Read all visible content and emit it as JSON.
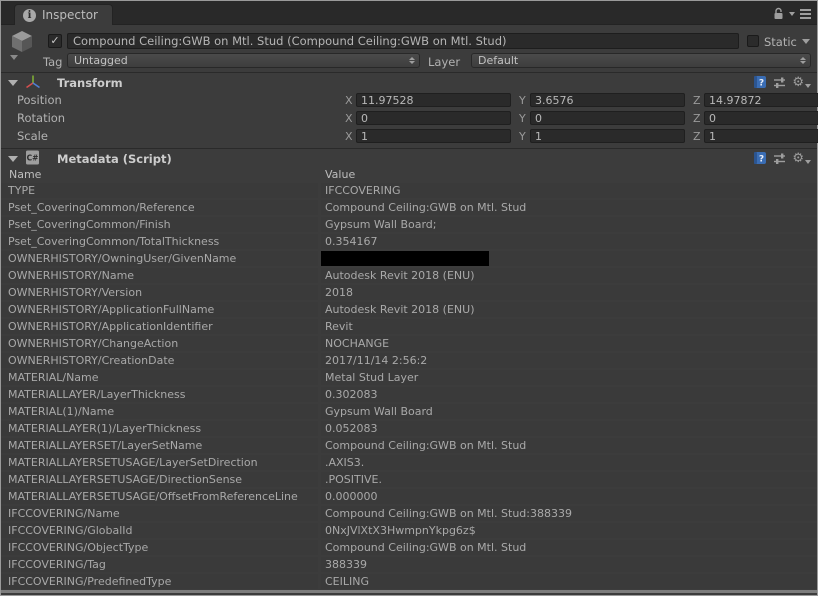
{
  "window": {
    "tab": "Inspector"
  },
  "game_object": {
    "name": "Compound Ceiling:GWB on Mtl. Stud (Compound Ceiling:GWB on Mtl. Stud)",
    "active": true,
    "static_label": "Static",
    "static_checked": false,
    "tag_label": "Tag",
    "tag_value": "Untagged",
    "layer_label": "Layer",
    "layer_value": "Default"
  },
  "transform": {
    "title": "Transform",
    "axis_labels": {
      "x": "X",
      "y": "Y",
      "z": "Z"
    },
    "rows": [
      {
        "label": "Position",
        "key": "position",
        "x": "11.97528",
        "y": "3.6576",
        "z": "14.97872"
      },
      {
        "label": "Rotation",
        "key": "rotation",
        "x": "0",
        "y": "0",
        "z": "0"
      },
      {
        "label": "Scale",
        "key": "scale",
        "x": "1",
        "y": "1",
        "z": "1"
      }
    ]
  },
  "metadata": {
    "title": "Metadata (Script)",
    "columns": [
      "Name",
      "Value"
    ],
    "rows": [
      {
        "name": "TYPE",
        "value": "IFCCOVERING"
      },
      {
        "name": "Pset_CoveringCommon/Reference",
        "value": "Compound Ceiling:GWB on Mtl. Stud"
      },
      {
        "name": "Pset_CoveringCommon/Finish",
        "value": "Gypsum Wall Board;"
      },
      {
        "name": "Pset_CoveringCommon/TotalThickness",
        "value": "0.354167"
      },
      {
        "name": "OWNERHISTORY/OwningUser/GivenName",
        "value": "",
        "redacted": true
      },
      {
        "name": "OWNERHISTORY/Name",
        "value": "Autodesk Revit 2018 (ENU)"
      },
      {
        "name": "OWNERHISTORY/Version",
        "value": "2018"
      },
      {
        "name": "OWNERHISTORY/ApplicationFullName",
        "value": "Autodesk Revit 2018 (ENU)"
      },
      {
        "name": "OWNERHISTORY/ApplicationIdentifier",
        "value": "Revit"
      },
      {
        "name": "OWNERHISTORY/ChangeAction",
        "value": "NOCHANGE"
      },
      {
        "name": "OWNERHISTORY/CreationDate",
        "value": "2017/11/14 2:56:2"
      },
      {
        "name": "MATERIAL/Name",
        "value": "Metal Stud Layer"
      },
      {
        "name": "MATERIALLAYER/LayerThickness",
        "value": "0.302083"
      },
      {
        "name": "MATERIAL(1)/Name",
        "value": "Gypsum Wall Board"
      },
      {
        "name": "MATERIALLAYER(1)/LayerThickness",
        "value": "0.052083"
      },
      {
        "name": "MATERIALLAYERSET/LayerSetName",
        "value": "Compound Ceiling:GWB on Mtl. Stud"
      },
      {
        "name": "MATERIALLAYERSETUSAGE/LayerSetDirection",
        "value": ".AXIS3."
      },
      {
        "name": "MATERIALLAYERSETUSAGE/DirectionSense",
        "value": ".POSITIVE."
      },
      {
        "name": "MATERIALLAYERSETUSAGE/OffsetFromReferenceLine",
        "value": "0.000000"
      },
      {
        "name": "IFCCOVERING/Name",
        "value": "Compound Ceiling:GWB on Mtl. Stud:388339"
      },
      {
        "name": "IFCCOVERING/GlobalId",
        "value": "0NxJVlXtX3HwmpnYkpg6z$"
      },
      {
        "name": "IFCCOVERING/ObjectType",
        "value": "Compound Ceiling:GWB on Mtl. Stud"
      },
      {
        "name": "IFCCOVERING/Tag",
        "value": "388339"
      },
      {
        "name": "IFCCOVERING/PredefinedType",
        "value": "CEILING"
      }
    ]
  },
  "colors": {
    "panel_bg": "#3c3c3c",
    "tabbar_bg": "#292929",
    "field_bg": "#2a2a2a",
    "row_bg": "#3a3a3a",
    "text": "#b2b2b2",
    "help_icon_blue": "#3a6db4",
    "axis_red": "#d34f4f",
    "axis_green": "#7fae35",
    "axis_blue": "#4f7fd3",
    "redaction": "#000000"
  }
}
